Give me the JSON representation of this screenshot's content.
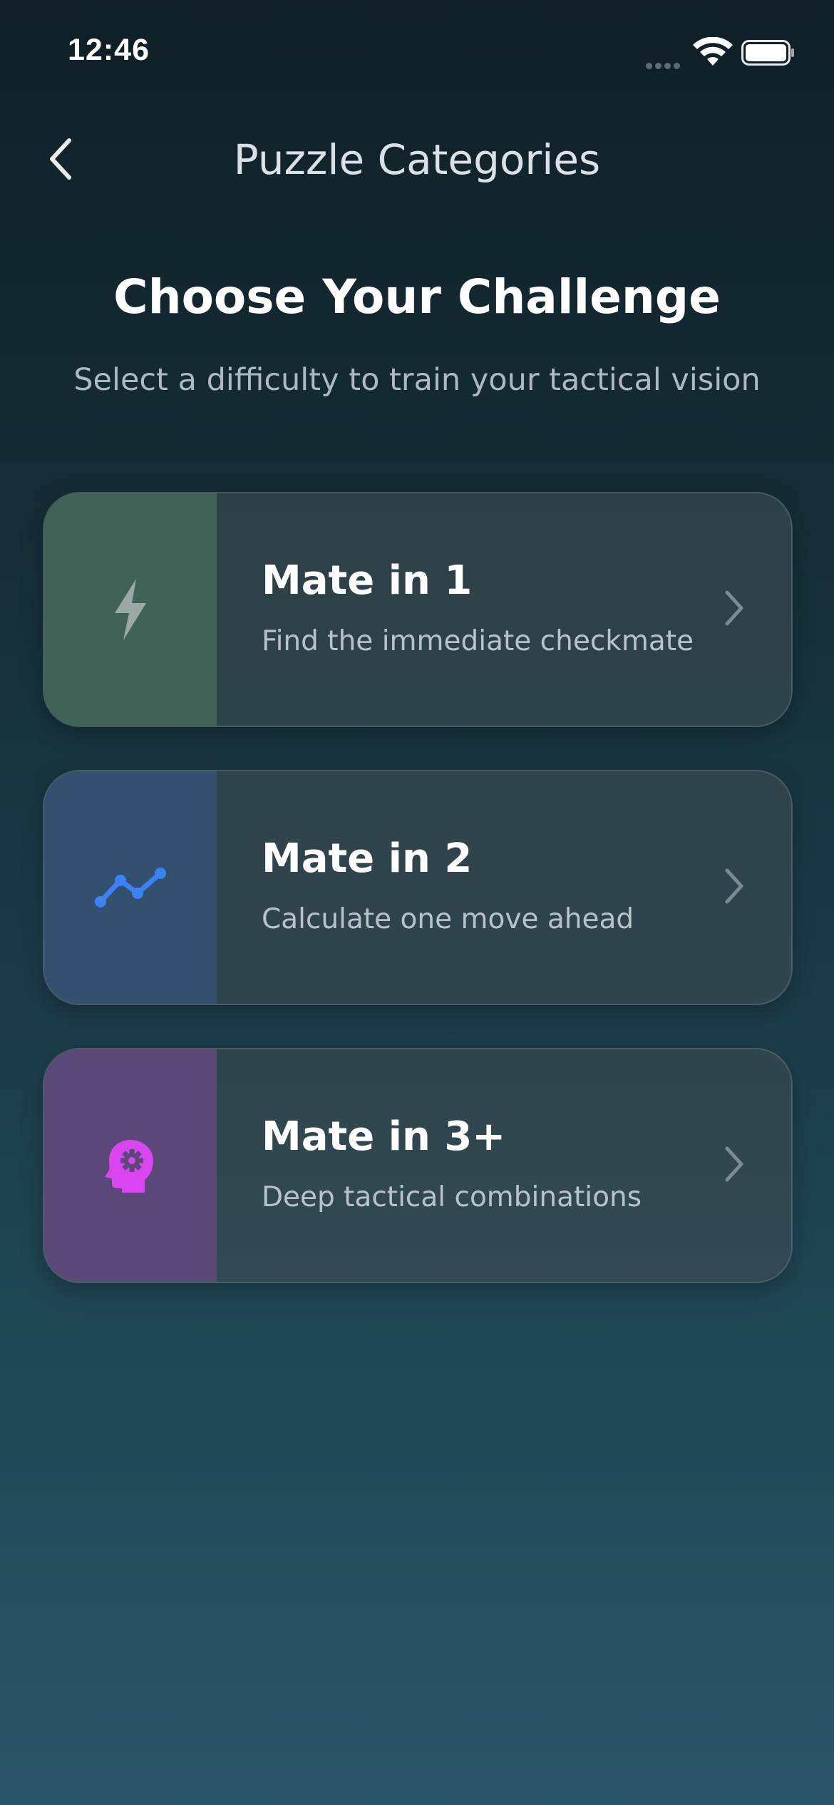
{
  "status_bar": {
    "time": "12:46"
  },
  "nav": {
    "title": "Puzzle Categories"
  },
  "hero": {
    "title": "Choose Your Challenge",
    "subtitle": "Select a difficulty to train your tactical vision"
  },
  "categories": [
    {
      "title": "Mate in 1",
      "subtitle": "Find the immediate checkmate",
      "icon": "lightning-icon",
      "panel_color": "#3f6457",
      "icon_color": "#9aa8a6"
    },
    {
      "title": "Mate in 2",
      "subtitle": "Calculate one move ahead",
      "icon": "trend-line-icon",
      "panel_color": "#33506e",
      "icon_color": "#3b82f6"
    },
    {
      "title": "Mate in 3+",
      "subtitle": "Deep tactical combinations",
      "icon": "brain-gear-icon",
      "panel_color": "#5a4878",
      "icon_color": "#d946ef"
    }
  ],
  "colors": {
    "background_top": "#101f27",
    "background_bottom": "#2a5566",
    "card_background": "#3e4c52",
    "chevron": "#7d8b91"
  }
}
